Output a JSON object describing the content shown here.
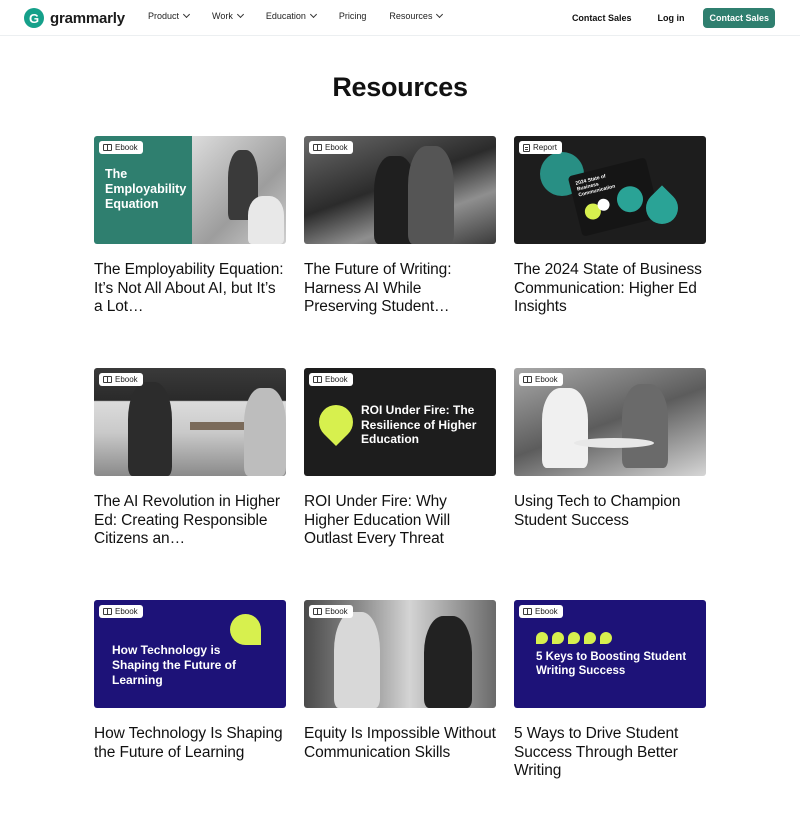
{
  "header": {
    "logo_text": "grammarly",
    "logo_letter": "G",
    "nav": [
      "Product",
      "Work",
      "Education",
      "Pricing",
      "Resources"
    ],
    "contact_sales_link": "Contact Sales",
    "login": "Log in",
    "contact_sales_button": "Contact Sales"
  },
  "page": {
    "title": "Resources"
  },
  "colors": {
    "brand": "#2f7f6f",
    "navy": "#1d1278",
    "lime": "#d7f04e"
  },
  "cards": [
    {
      "badge": "Ebook",
      "badge_icon": "book-icon",
      "art_text": "The Employability Equation",
      "title": "The Employability Equation: It’s Not All About AI, but It’s a Lot…"
    },
    {
      "badge": "Ebook",
      "badge_icon": "book-icon",
      "art_text": "",
      "title": "The Future of Writing: Harness AI While Preserving Student…"
    },
    {
      "badge": "Report",
      "badge_icon": "report-icon",
      "art_text": "2024 State of Business Communication",
      "title": "The 2024 State of Business Communication: Higher Ed Insights"
    },
    {
      "badge": "Ebook",
      "badge_icon": "book-icon",
      "art_text": "",
      "title": "The AI Revolution in Higher Ed: Creating Responsible Citizens an…"
    },
    {
      "badge": "Ebook",
      "badge_icon": "book-icon",
      "art_text": "ROI Under Fire: The Resilience of Higher Education",
      "title": "ROI Under Fire: Why Higher Education Will Outlast Every Threat"
    },
    {
      "badge": "Ebook",
      "badge_icon": "book-icon",
      "art_text": "",
      "title": "Using Tech to Champion Student Success"
    },
    {
      "badge": "Ebook",
      "badge_icon": "book-icon",
      "art_text": "How Technology is Shaping the Future of Learning",
      "title": "How Technology Is Shaping the Future of Learning"
    },
    {
      "badge": "Ebook",
      "badge_icon": "book-icon",
      "art_text": "",
      "title": "Equity Is Impossible Without Communication Skills"
    },
    {
      "badge": "Ebook",
      "badge_icon": "book-icon",
      "art_text": "5 Keys to Boosting Student Writing Success",
      "title": "5 Ways to Drive Student Success Through Better Writing"
    }
  ]
}
